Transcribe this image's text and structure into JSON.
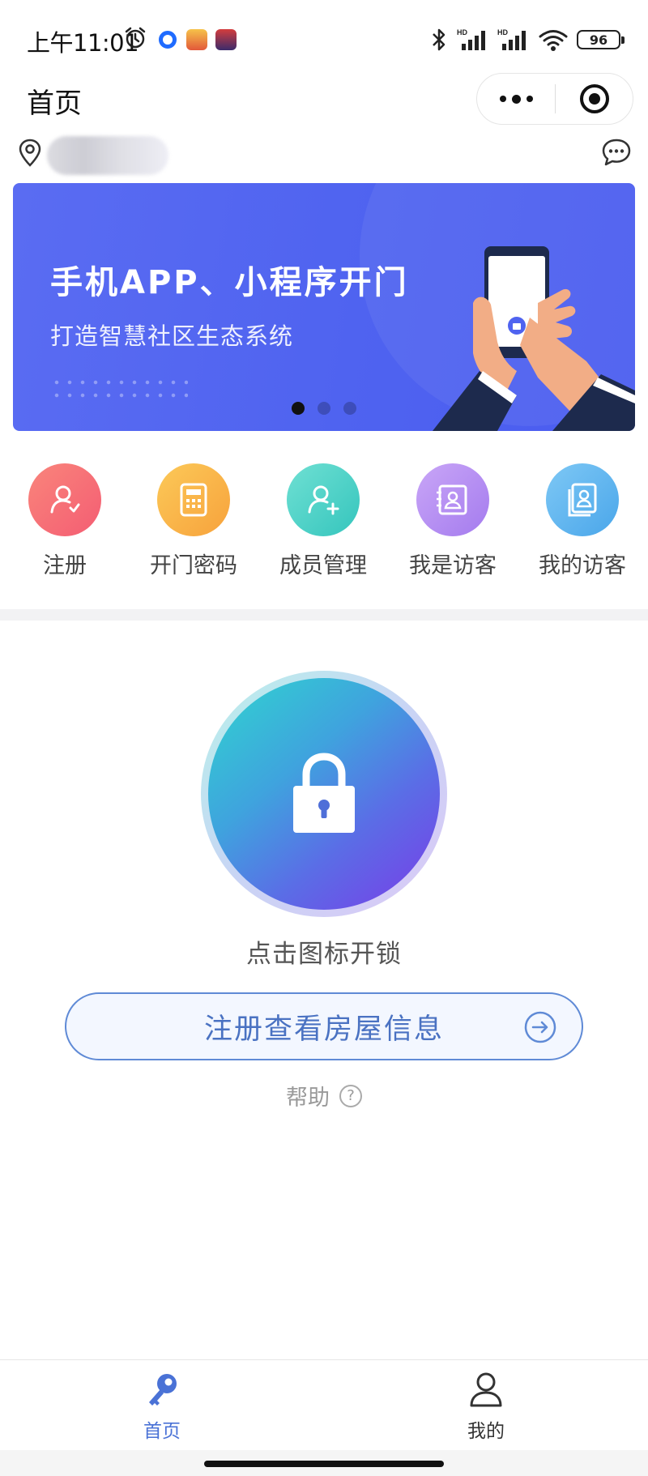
{
  "status_bar": {
    "time": "上午11:01",
    "battery": "96",
    "network_label": "HD"
  },
  "nav": {
    "title": "首页"
  },
  "banner": {
    "title": "手机APP、小程序开门",
    "subtitle": "打造智慧社区生态系统",
    "slides": 3,
    "active_slide": 1,
    "color": "#4f63f0"
  },
  "quick_actions": [
    {
      "label": "注册",
      "icon": "user-check-icon",
      "color_from": "#f9857b",
      "color_to": "#f45d73"
    },
    {
      "label": "开门密码",
      "icon": "calculator-icon",
      "color_from": "#fcc958",
      "color_to": "#f7a23c"
    },
    {
      "label": "成员管理",
      "icon": "add-user-icon",
      "color_from": "#6fe0d3",
      "color_to": "#35c5bd"
    },
    {
      "label": "我是访客",
      "icon": "contact-card-icon",
      "color_from": "#c9a6f7",
      "color_to": "#a47bee"
    },
    {
      "label": "我的访客",
      "icon": "contact-book-icon",
      "color_from": "#7ec8f5",
      "color_to": "#4aa6ea"
    }
  ],
  "unlock": {
    "label": "点击图标开锁"
  },
  "register_button": {
    "label": "注册查看房屋信息"
  },
  "help": {
    "label": "帮助",
    "icon": "?"
  },
  "tabbar": {
    "tabs": [
      {
        "label": "首页",
        "icon": "key-icon",
        "active": true
      },
      {
        "label": "我的",
        "icon": "person-icon",
        "active": false
      }
    ],
    "active_color": "#4a72d6"
  }
}
